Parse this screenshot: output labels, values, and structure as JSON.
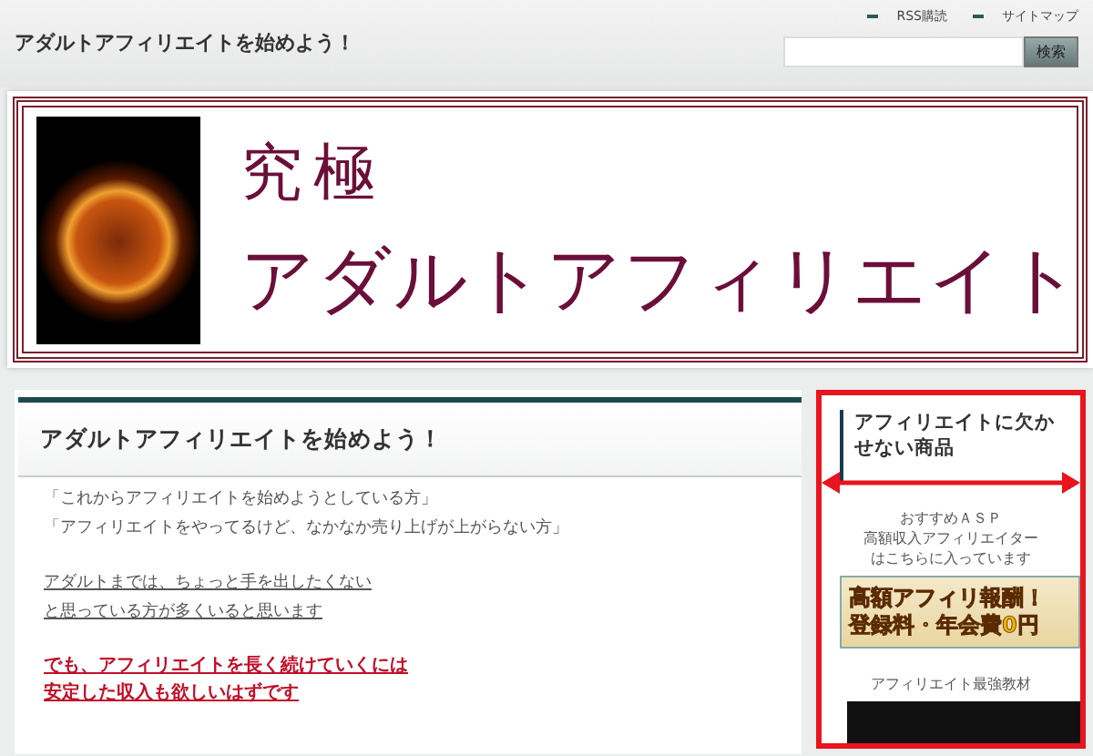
{
  "header": {
    "site_title": "アダルトアフィリエイトを始めよう！",
    "links": [
      "RSS購読",
      "サイトマップ"
    ],
    "search": {
      "button": "検索"
    }
  },
  "banner": {
    "title_line1": "究極",
    "title_line2": "アダルトアフィリエイト"
  },
  "article": {
    "heading": "アダルトアフィリエイトを始めよう！",
    "paragraphs": [
      {
        "kind": "plain",
        "lines": [
          "「これからアフィリエイトを始めようとしている方」",
          "「アフィリエイトをやってるけど、なかなか売り上げが上がらない方」"
        ]
      },
      {
        "kind": "underlined",
        "lines": [
          "アダルトまでは、ちょっと手を出したくない",
          "と思っている方が多くいると思います"
        ]
      },
      {
        "kind": "emphasis",
        "lines": [
          "でも、アフィリエイトを長く続けていくには",
          "安定した収入も欲しいはずです"
        ]
      }
    ]
  },
  "sidebar": {
    "heading": "アフィリエイトに欠かせない商品",
    "widgets": [
      {
        "kind": "ad",
        "caption_lines": [
          "おすすめＡＳＰ",
          "高額収入アフィリエイター",
          "はこちらに入っています"
        ],
        "banner_lines": [
          "高額アフィリ報酬！",
          "登録料・年会費0円"
        ]
      },
      {
        "kind": "image",
        "caption_lines": [
          "アフィリエイト最強教材"
        ]
      }
    ]
  }
}
